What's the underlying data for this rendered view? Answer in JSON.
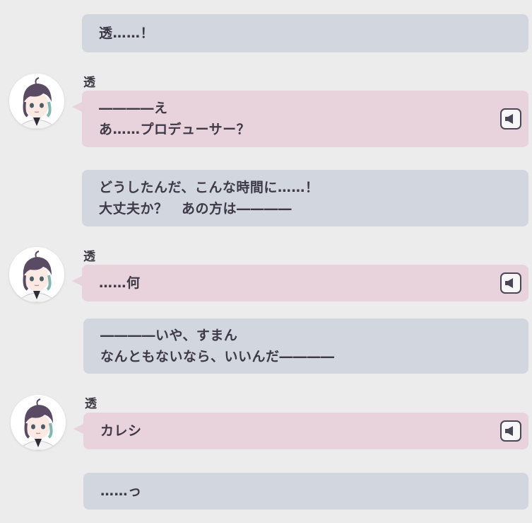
{
  "messages": [
    {
      "type": "player",
      "lines": [
        "透……！"
      ]
    },
    {
      "type": "character",
      "speaker": "透",
      "lines": [
        "――――え",
        "あ……プロデューサー？"
      ],
      "voice_icon": "speaker-icon"
    },
    {
      "type": "player",
      "lines": [
        "どうしたんだ、こんな時間に……！",
        "大丈夫か？　あの方は――――"
      ]
    },
    {
      "type": "character",
      "speaker": "透",
      "lines": [
        "……何"
      ],
      "voice_icon": "speaker-icon"
    },
    {
      "type": "player",
      "lines": [
        "――――いや、すまん",
        "なんともないなら、いいんだ――――"
      ]
    },
    {
      "type": "character",
      "speaker": "透",
      "lines": [
        "カレシ"
      ],
      "voice_icon": "speaker-icon"
    },
    {
      "type": "player",
      "lines": [
        "……っ"
      ]
    }
  ],
  "colors": {
    "background": "#ececec",
    "player_bubble": "#d2d6de",
    "character_bubble": "#e8d2dc",
    "text": "#3d3946"
  }
}
